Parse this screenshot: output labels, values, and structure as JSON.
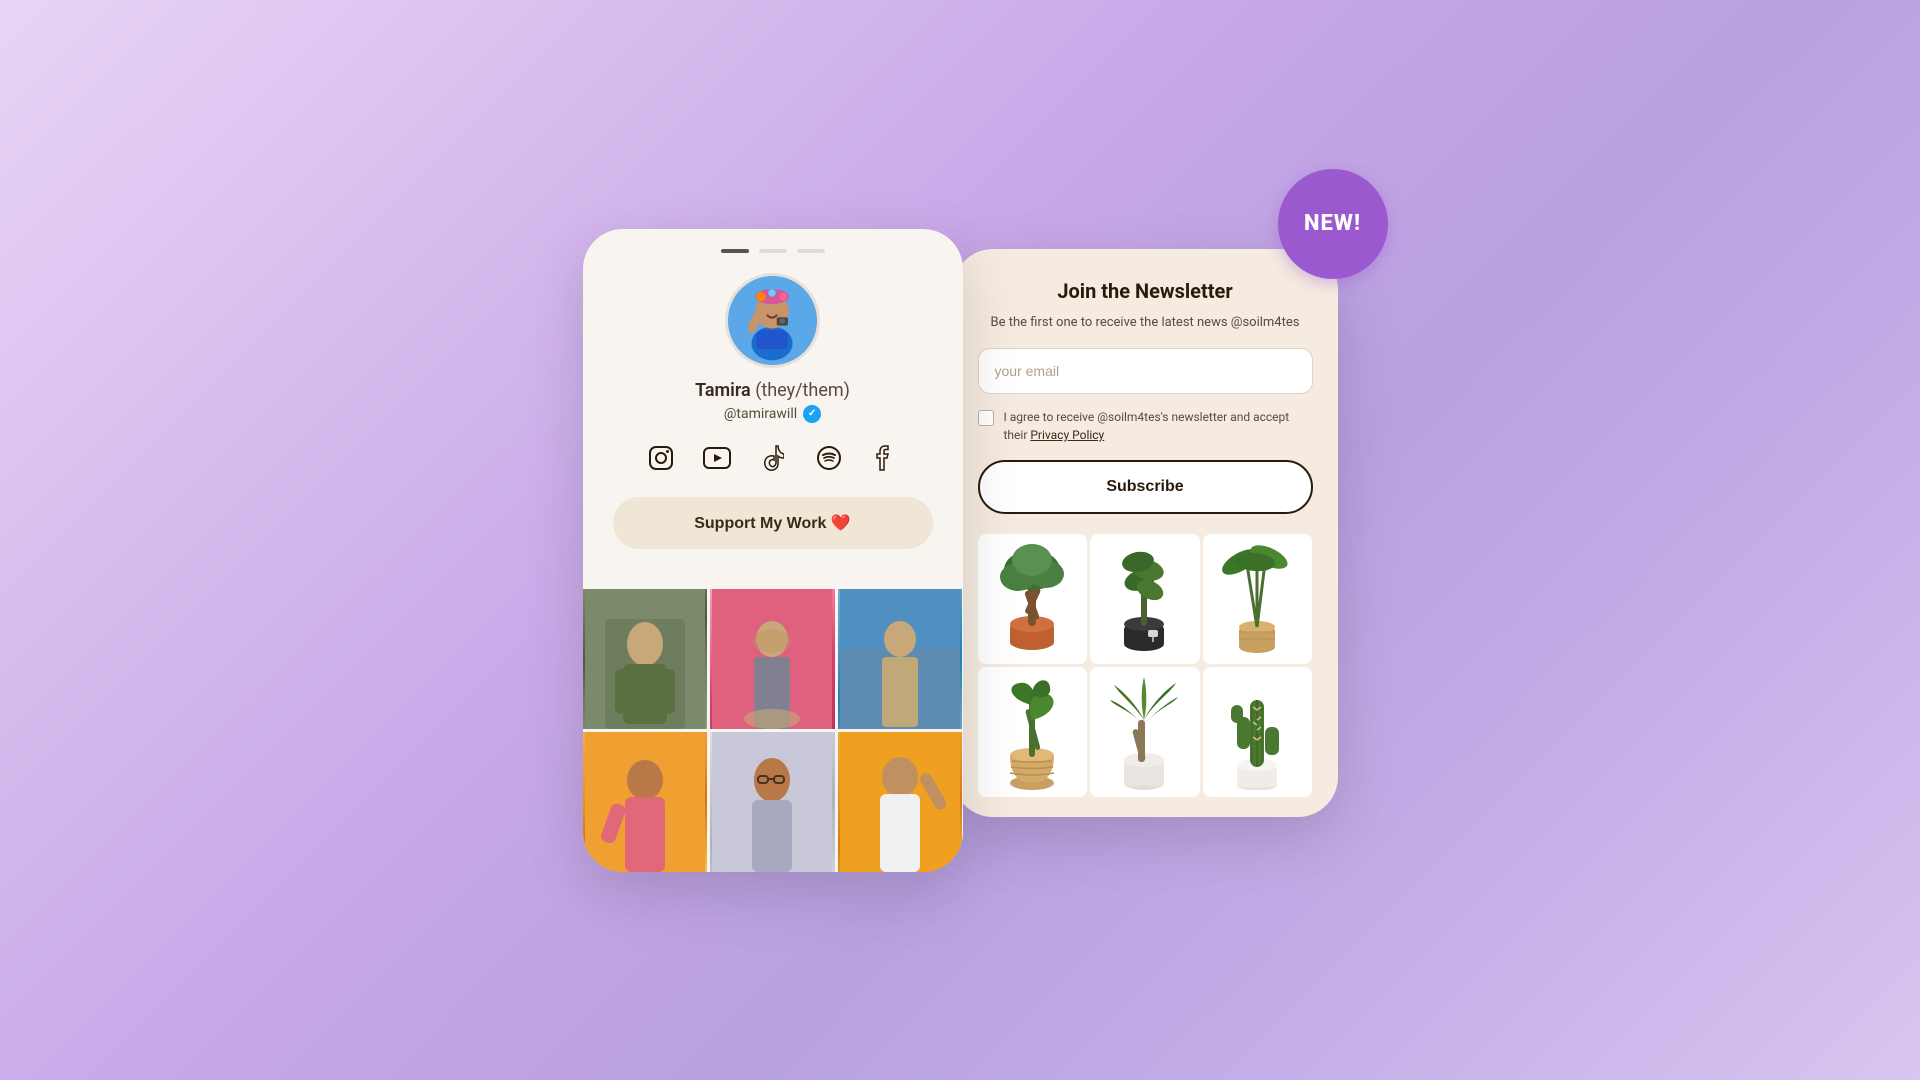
{
  "page": {
    "background": "linear-gradient(135deg, #e8d5f5, #c9a8e8, #b8a0e0, #d8c5f0)",
    "new_badge": "NEW!"
  },
  "profile": {
    "name": "Tamira",
    "pronouns": "(they/them)",
    "handle": "@tamirawill",
    "verified": true,
    "support_button": "Support My Work ❤️",
    "indicators": [
      "active",
      "inactive",
      "inactive"
    ]
  },
  "social_icons": {
    "instagram": "📷",
    "youtube": "▶",
    "tiktok": "♪",
    "spotify": "🎵",
    "facebook": "f"
  },
  "newsletter": {
    "title": "Join the Newsletter",
    "description": "Be the first one to receive the latest news @soilm4tes",
    "email_placeholder": "your email",
    "consent_text": "I agree to receive @soilm4tes's newsletter and accept their ",
    "privacy_policy_link": "Privacy Policy",
    "subscribe_button": "Subscribe"
  },
  "photos": [
    {
      "id": 1,
      "label": "photo-green-jacket"
    },
    {
      "id": 2,
      "label": "photo-pink-background"
    },
    {
      "id": 3,
      "label": "photo-blue-wall"
    },
    {
      "id": 4,
      "label": "photo-yellow-bg-1"
    },
    {
      "id": 5,
      "label": "photo-silver"
    },
    {
      "id": 6,
      "label": "photo-yellow-bg-2"
    }
  ],
  "plants": [
    {
      "id": 1,
      "label": "bonsai-pot"
    },
    {
      "id": 2,
      "label": "dark-pot-plant"
    },
    {
      "id": 3,
      "label": "tall-leaves"
    },
    {
      "id": 4,
      "label": "basket-plant"
    },
    {
      "id": 5,
      "label": "dracaena"
    },
    {
      "id": 6,
      "label": "cactus"
    }
  ]
}
